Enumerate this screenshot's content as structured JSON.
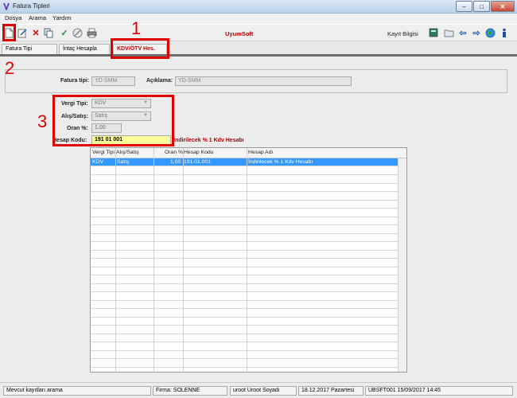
{
  "window": {
    "title": "Fatura Tipleri",
    "min_glyph": "–",
    "max_glyph": "□",
    "close_glyph": "✕"
  },
  "menu": {
    "items": [
      "Dosya",
      "Arama",
      "Yardım"
    ]
  },
  "toolbar": {
    "brand": "UyumSoft",
    "kayit_label": "Kayıt Bilgisi"
  },
  "tabs": [
    {
      "label": "Fatura Tipi"
    },
    {
      "label": "İntaç Hesapla"
    },
    {
      "label": "KDV/ÖTV Hes."
    }
  ],
  "header": {
    "fatura_tipi_label": "Fatura tipi:",
    "fatura_tipi_value": "YD-SMM",
    "aciklama_label": "Açıklama:",
    "aciklama_value": "YD-SMM"
  },
  "form": {
    "vergi_tipi_label": "Vergi Tipi:",
    "vergi_tipi_value": "KDV",
    "alis_satis_label": "Alış/Satış:",
    "alis_satis_value": "Satış",
    "oran_label": "Oran %:",
    "oran_value": "1,00",
    "hesap_kodu_label": "Hesap Kodu:",
    "hesap_kodu_value": "191 01 001",
    "hesap_adi": "İndirilecek % 1 Kdv Hesabı"
  },
  "annotations": {
    "n1": "1",
    "n2": "2",
    "n3": "3"
  },
  "grid": {
    "columns": [
      "Vergi Tipi",
      "Alış/Satış",
      "Oran %",
      "Hesap Kodu",
      "Hesap Adı"
    ],
    "rows": [
      {
        "vergi_tipi": "KDV",
        "alis_satis": "Satış",
        "oran": "1,00",
        "hesap_kodu": "191.01.001",
        "hesap_adi": "İndirilecek % 1 Kdv Hesabı"
      }
    ]
  },
  "statusbar": {
    "message": "Mevcut kayıtları arama",
    "firma": "Firma: SOLENNE",
    "user": "uroot Uroot Soyadı",
    "date": "18.12.2017  Pazartesi",
    "version": "UBSFT001 15/09/2017 14:45"
  },
  "colors": {
    "accent_red": "#c00000",
    "annotation_red": "#e00000",
    "selection_blue": "#3399ff",
    "hesap_kodu_bg": "#ffff99"
  }
}
